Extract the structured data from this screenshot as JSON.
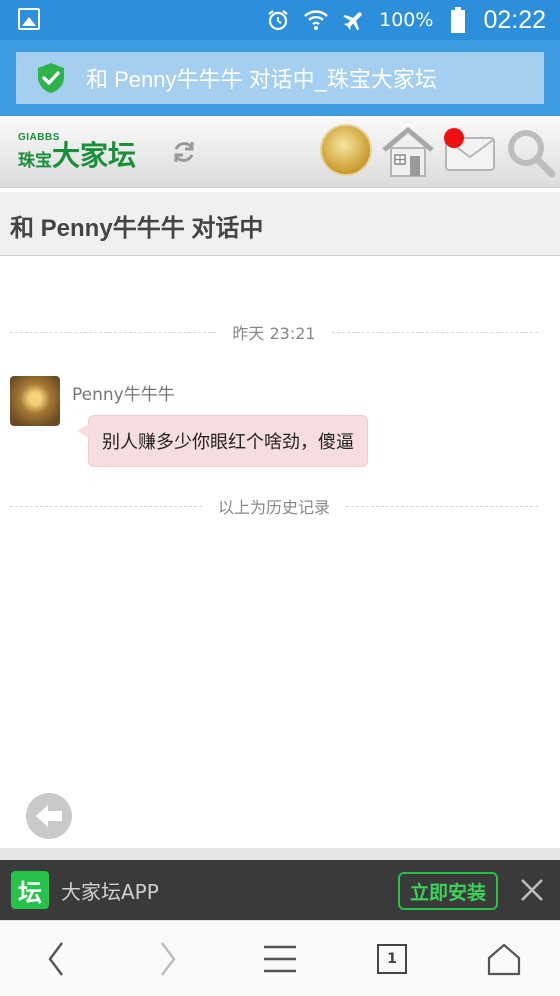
{
  "status_bar": {
    "battery": "100%",
    "time": "02:22",
    "icons": [
      "gallery-icon",
      "alarm-icon",
      "wifi-icon",
      "airplane-icon",
      "battery-icon"
    ]
  },
  "title_bar": {
    "title": "和 Penny牛牛牛 对话中_珠宝大家坛"
  },
  "site_header": {
    "logo_small": "GIABBS",
    "logo_zhubao": "珠宝",
    "logo_big": "大家坛"
  },
  "conversation": {
    "title": "和 Penny牛牛牛 对话中",
    "timestamp": "昨天 23:21",
    "messages": [
      {
        "sender": "Penny牛牛牛",
        "text": "别人赚多少你眼红个啥劲，傻逼"
      }
    ],
    "history_label": "以上为历史记录"
  },
  "app_banner": {
    "logo_char": "坛",
    "name": "大家坛APP",
    "install_label": "立即安装"
  },
  "browser_bar": {
    "tab_count": "1"
  },
  "colors": {
    "status_bar": "#2b8fdb",
    "title_bar": "#3d9be0",
    "brand_green": "#1a8f3a",
    "bubble": "#f6dde0",
    "app_green": "#27c24a"
  }
}
